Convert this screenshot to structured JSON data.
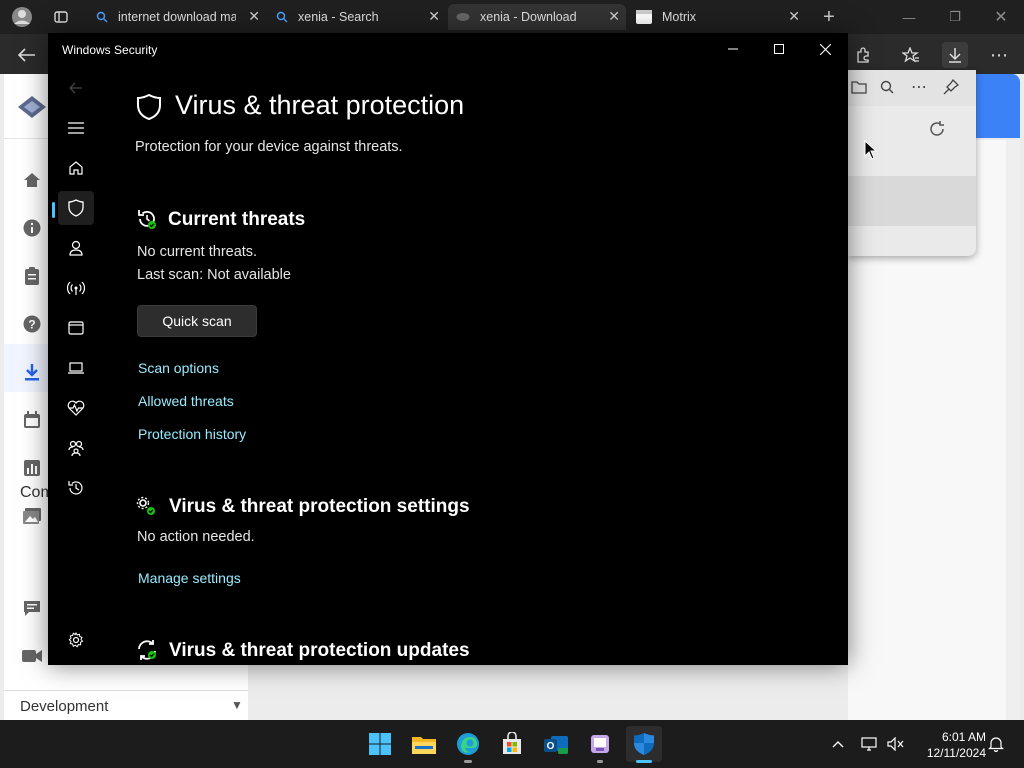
{
  "browser": {
    "tabs": [
      {
        "title": "internet download ma",
        "active": false
      },
      {
        "title": "xenia - Search",
        "active": false
      },
      {
        "title": "xenia - Download",
        "active": true
      },
      {
        "title": "Motrix",
        "active": false
      }
    ],
    "new_tab_symbol": "+"
  },
  "background_page": {
    "left_nav_section": "Com",
    "footer_section": "Development"
  },
  "window": {
    "title": "Windows Security",
    "controls": {
      "minimize": "—",
      "maximize": "☐",
      "close": "✕"
    }
  },
  "nav": {
    "items": [
      {
        "icon": "back-arrow-icon"
      },
      {
        "icon": "hamburger-icon"
      },
      {
        "icon": "home-icon"
      },
      {
        "icon": "shield-icon",
        "selected": true
      },
      {
        "icon": "person-icon"
      },
      {
        "icon": "wifi-icon"
      },
      {
        "icon": "browser-window-icon"
      },
      {
        "icon": "laptop-icon"
      },
      {
        "icon": "heart-pulse-icon"
      },
      {
        "icon": "family-icon"
      },
      {
        "icon": "history-icon"
      },
      {
        "icon": "settings-gear-icon"
      }
    ]
  },
  "content": {
    "page_title": "Virus & threat protection",
    "page_subtitle": "Protection for your device against threats.",
    "current_threats": {
      "heading": "Current threats",
      "status": "No current threats.",
      "last_scan": "Last scan: Not available",
      "quick_scan_button": "Quick scan",
      "links": [
        "Scan options",
        "Allowed threats",
        "Protection history"
      ]
    },
    "settings": {
      "heading": "Virus & threat protection settings",
      "status": "No action needed.",
      "link": "Manage settings"
    },
    "updates": {
      "heading": "Virus & threat protection updates"
    }
  },
  "taskbar": {
    "apps": [
      "start",
      "file-explorer",
      "edge",
      "store",
      "outlook",
      "app",
      "windows-security"
    ],
    "clock_time": "6:01 AM",
    "clock_date": "12/11/2024"
  },
  "colors": {
    "link": "#99ebff",
    "accent": "#4cc2ff",
    "window_bg": "#000000"
  }
}
